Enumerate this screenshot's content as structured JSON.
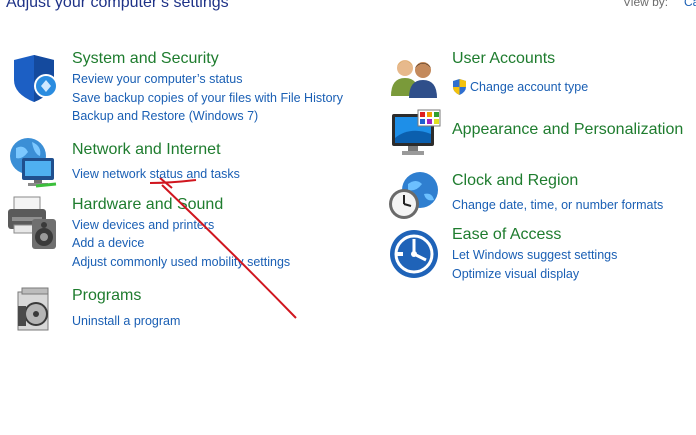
{
  "header": {
    "title": "Adjust your computer’s settings",
    "view_by_label": "View by:",
    "view_by_value": "Ca"
  },
  "categories": [
    {
      "title": "System and Security",
      "icon": "shield-icon",
      "links": [
        "Review your computer’s status",
        "Save backup copies of your files with File History",
        "Backup and Restore (Windows 7)"
      ]
    },
    {
      "title": "Network and Internet",
      "icon": "network-globe-icon",
      "links": [
        "View network status and tasks"
      ]
    },
    {
      "title": "Hardware and Sound",
      "icon": "printer-speaker-icon",
      "links": [
        "View devices and printers",
        "Add a device",
        "Adjust commonly used mobility settings"
      ]
    },
    {
      "title": "Programs",
      "icon": "programs-disc-icon",
      "links": [
        "Uninstall a program"
      ]
    },
    {
      "title": "User Accounts",
      "icon": "users-icon",
      "links": [
        "Change account type"
      ]
    },
    {
      "title": "Appearance and Personalization",
      "icon": "monitor-palette-icon",
      "links": []
    },
    {
      "title": "Clock and Region",
      "icon": "clock-globe-icon",
      "links": [
        "Change date, time, or number formats"
      ]
    },
    {
      "title": "Ease of Access",
      "icon": "ease-of-access-icon",
      "links": [
        "Let Windows suggest settings",
        "Optimize visual display"
      ]
    }
  ],
  "colors": {
    "title_green": "#1e7c2e",
    "link_blue": "#1a5fb4",
    "annotation_red": "#d0161f"
  }
}
